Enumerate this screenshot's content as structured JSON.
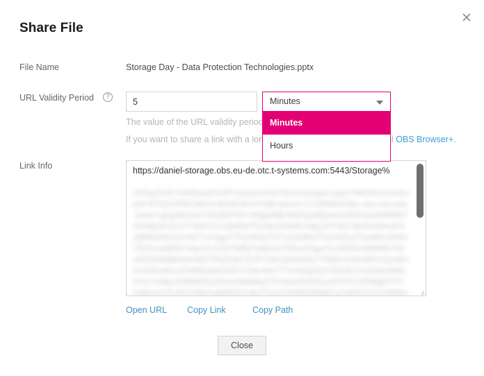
{
  "dialog": {
    "title": "Share File",
    "close_icon": "close-icon"
  },
  "file_name": {
    "label": "File Name",
    "value": "Storage Day - Data Protection Technologies.pptx"
  },
  "validity": {
    "label": "URL Validity Period",
    "help_icon": "?",
    "value": "5",
    "unit_selected": "Minutes",
    "unit_options": [
      "Minutes",
      "Hours"
    ],
    "caret_icon": "chevron-down-icon",
    "hint_line_1": "The value of the URL validity period is",
    "hint_line_2_before": "If you want to share a link with a long",
    "hint_line_2_tail": "ol ",
    "hint_link": "OBS Browser+",
    "hint_line_2_end": "."
  },
  "link_info": {
    "label": "Link Info",
    "url_text": "https://daniel-storage.obs.eu-de.otc.t-systems.com:5443/Storage%",
    "redacted_text": "20Day%20-%20Data%20Protection%20Technologies.pptx?AWSAccessKeyId=RTQXZPMCBKVLNDSEWUFG&Expires=1718894433&x-obs-security-token=gQpldS1kZTEKjIEFRhYxNjg5MjE4NDQyMjQwNzI5NDQwMWM5Y2VhMjJhYjUxYTM3Y2YzZjM0NTEyNjJmNWExNjQ2OTlkZTBhNzI0NmE4ZjBlNGNkYjJmNTYwYjgyYTFjOWQ2Y2YyODBhZTAzN2EyZTkwMmZiMmY5ZDcyMjRkYzkyOGY2OTNlNjYyNjVhOTRmZDgwYjc2NDhmMWM5YWU0ZDNiMjBhNmRjOTRiZDdhYjU0Y2MzZjhiNzEyYTllNDJmNzM5YzQzMmIxOGEwNzc0ZWMyMzE4ZGY1MmMzYTVmNzg4ZjY2NGE1YzA5NzM4NDYyYmMyZDM5MDQ2NmU5MjMwZTFmNmE0ODczNTE5Y2RiMjg0YTFmMmIxOTc2NTI4NjYwNDE5YzdhZTQzZTc0M2Q5MjYyZmE4Y2U1ZWNmNDJlNGI2N2U1MDJhMWY3MzBhYzE0YzIwYmE4ZjQwZTUzNzE4ZmJkOTJmMzAzZjVjJnNpZ25hdHVyZT1oT2dZJTJGMG1hWmx0&Signature=8tKmQeTbV2cHnJ9Lx%2BrWd0Yf5Ag%3D"
  },
  "actions": {
    "open_url": "Open URL",
    "copy_link": "Copy Link",
    "copy_path": "Copy Path"
  },
  "footer": {
    "close_label": "Close"
  },
  "colors": {
    "accent_magenta": "#e20074",
    "link_blue": "#3f92c0",
    "hint_gray": "#b4b4b4"
  }
}
